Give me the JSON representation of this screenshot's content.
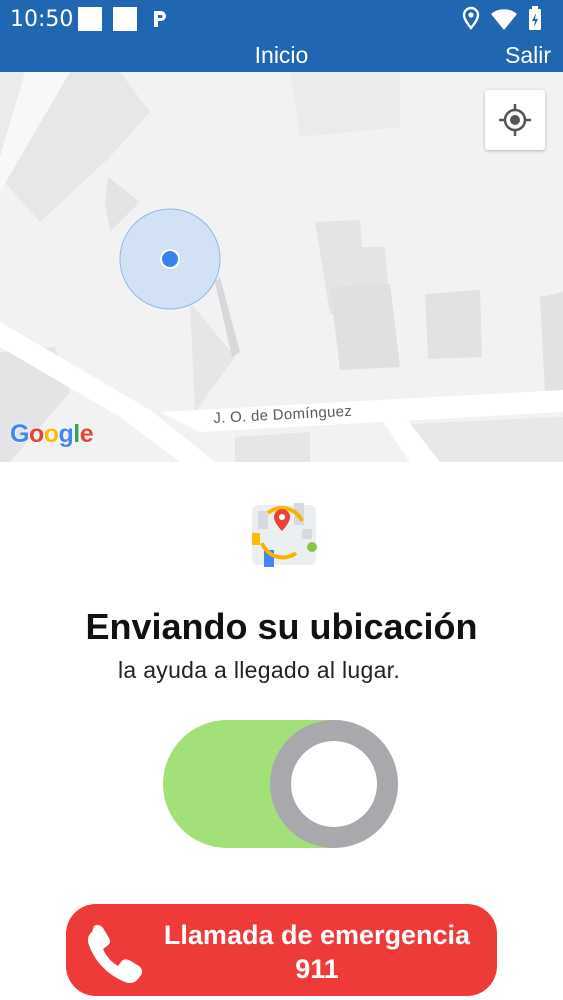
{
  "status_bar": {
    "time": "10:50"
  },
  "app_bar": {
    "title": "Inicio",
    "exit_label": "Salir"
  },
  "map": {
    "street_label": "J. O. de Domínguez",
    "attribution": "Google"
  },
  "content": {
    "title": "Enviando su ubicación",
    "subtitle": "la ayuda a llegado al lugar.",
    "toggle_on": true
  },
  "emergency_button": {
    "line1": "Llamada de emergencia",
    "line2": "911"
  },
  "colors": {
    "app_bar": "#2066b0",
    "toggle_track": "#a3e07a",
    "toggle_knob": "#a9a8ad",
    "emergency": "#ef3a3a",
    "location_dot": "#3b82f0"
  },
  "icons": [
    "location-pin-icon",
    "wifi-icon",
    "battery-charging-icon",
    "my-location-icon",
    "phone-icon",
    "parking-icon"
  ]
}
